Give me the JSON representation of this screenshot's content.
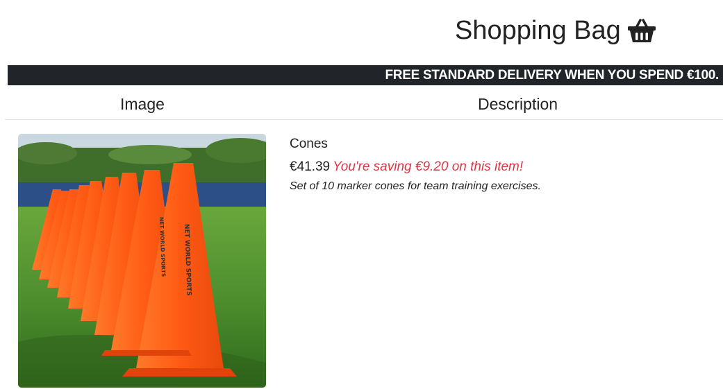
{
  "header": {
    "title": "Shopping Bag",
    "icon": "shopping-basket-icon"
  },
  "banner": {
    "text": "FREE STANDARD DELIVERY WHEN YOU SPEND €100."
  },
  "table": {
    "columns": [
      "Image",
      "Description"
    ]
  },
  "items": [
    {
      "name": "Cones",
      "price": "€41.39",
      "saving": "You're saving €9.20 on this item!",
      "description": "Set of 10 marker cones for team training exercises.",
      "image_alt": "orange marker cones on grass"
    }
  ],
  "colors": {
    "banner_bg": "#212529",
    "saving_text": "#dc3545",
    "cone": "#ff5a14",
    "grass": "#4e8f2e"
  }
}
